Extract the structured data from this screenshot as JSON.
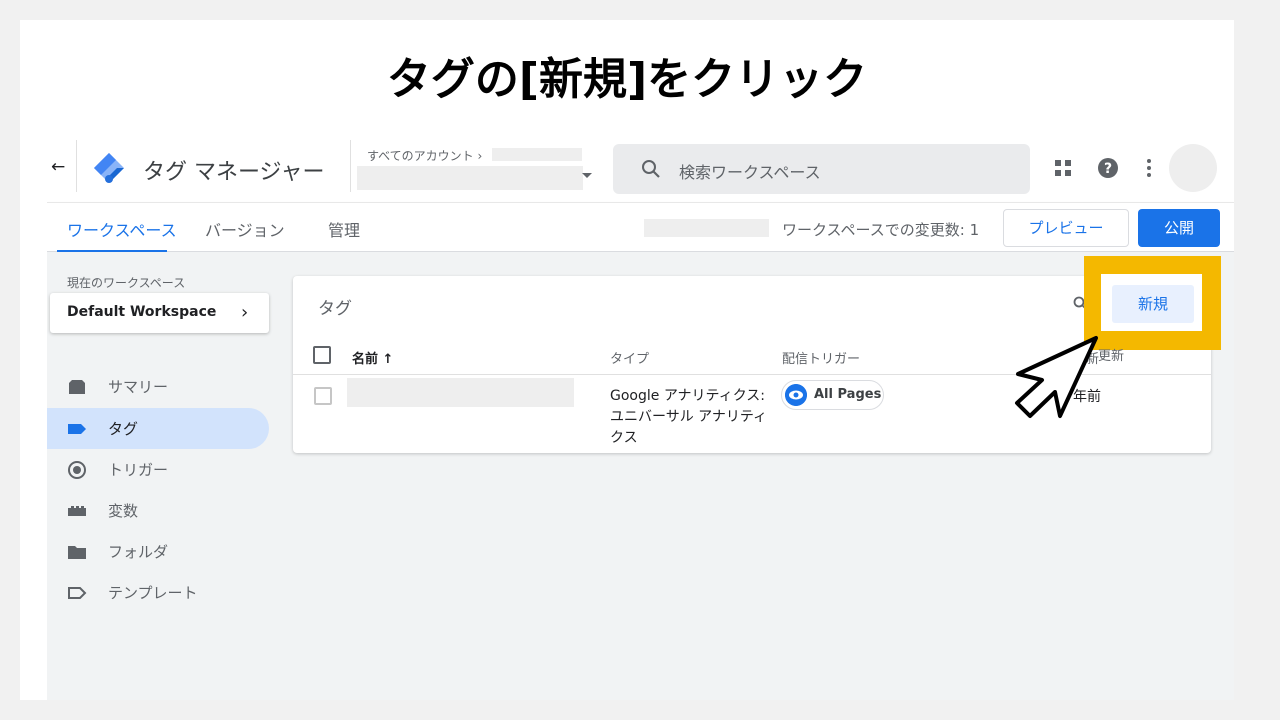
{
  "slide": {
    "title": "タグの[新規]をクリック"
  },
  "header": {
    "app_name": "タグ マネージャー",
    "account_label": "すべてのアカウント ›",
    "search_placeholder": "検索ワークスペース",
    "icons": [
      "arrow-back-icon",
      "gtm-logo-icon",
      "dropdown-arrow-icon",
      "search-icon",
      "apps-grid-icon",
      "help-icon",
      "more-vert-icon",
      "avatar"
    ]
  },
  "tabs": {
    "items": [
      {
        "label": "ワークスペース",
        "active": true
      },
      {
        "label": "バージョン",
        "active": false
      },
      {
        "label": "管理",
        "active": false
      }
    ],
    "changes_label": "ワークスペースでの変更数: 1",
    "preview_label": "プレビュー",
    "publish_label": "公開"
  },
  "sidebar": {
    "workspace_label": "現在のワークスペース",
    "workspace_name": "Default Workspace",
    "items": [
      {
        "label": "サマリー",
        "icon": "summary-icon",
        "active": false
      },
      {
        "label": "タグ",
        "icon": "tag-icon",
        "active": true
      },
      {
        "label": "トリガー",
        "icon": "trigger-icon",
        "active": false
      },
      {
        "label": "変数",
        "icon": "variables-icon",
        "active": false
      },
      {
        "label": "フォルダ",
        "icon": "folder-icon",
        "active": false
      },
      {
        "label": "テンプレート",
        "icon": "template-icon",
        "active": false
      }
    ]
  },
  "tags_panel": {
    "title": "タグ",
    "new_label": "新規",
    "columns": {
      "name": "名前 ↑",
      "type": "タイプ",
      "trigger": "配信トリガー",
      "updated": "更新"
    },
    "rows": [
      {
        "type": "Google アナリティクス: ユニバーサル アナリティクス",
        "trigger": "All Pages",
        "updated": "年前"
      }
    ]
  },
  "annotation": {
    "highlight_color": "#f4b800",
    "new_label": "新規",
    "updated_fragment": "更新"
  },
  "colors": {
    "accent": "#1a73e8",
    "active_nav_bg": "#d2e3fc",
    "highlight": "#f4b800"
  }
}
